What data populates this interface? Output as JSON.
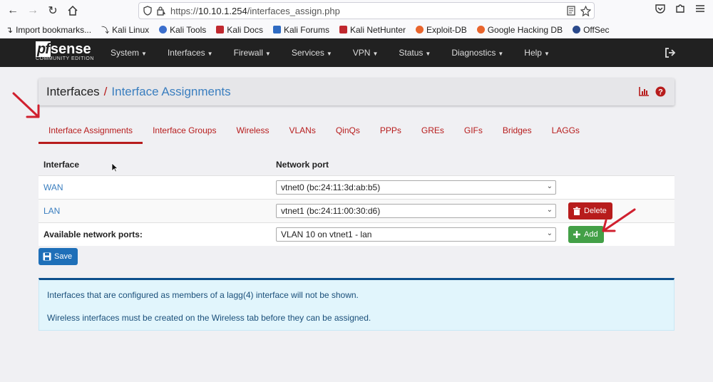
{
  "browser": {
    "url_prefix": "https://",
    "url_host": "10.10.1.254",
    "url_path": "/interfaces_assign.php",
    "bookmarks": [
      "Import bookmarks...",
      "Kali Linux",
      "Kali Tools",
      "Kali Docs",
      "Kali Forums",
      "Kali NetHunter",
      "Exploit-DB",
      "Google Hacking DB",
      "OffSec"
    ]
  },
  "navbar": {
    "logo_pf": "pf",
    "logo_sense": "sense",
    "logo_edition": "COMMUNITY EDITION",
    "menu": [
      "System",
      "Interfaces",
      "Firewall",
      "Services",
      "VPN",
      "Status",
      "Diagnostics",
      "Help"
    ]
  },
  "header": {
    "crumb_parent": "Interfaces",
    "separator": "/",
    "crumb_current": "Interface Assignments"
  },
  "tabs": [
    "Interface Assignments",
    "Interface Groups",
    "Wireless",
    "VLANs",
    "QinQs",
    "PPPs",
    "GREs",
    "GIFs",
    "Bridges",
    "LAGGs"
  ],
  "table": {
    "col_interface": "Interface",
    "col_port": "Network port",
    "rows": [
      {
        "name": "WAN",
        "port": "vtnet0 (bc:24:11:3d:ab:b5)"
      },
      {
        "name": "LAN",
        "port": "vtnet1 (bc:24:11:00:30:d6)",
        "action": "Delete"
      }
    ],
    "available_label": "Available network ports:",
    "available_value": "VLAN 10 on vtnet1 - lan",
    "add_label": "Add"
  },
  "save_label": "Save",
  "info": {
    "line1": "Interfaces that are configured as members of a lagg(4) interface will not be shown.",
    "line2": "Wireless interfaces must be created on the Wireless tab before they can be assigned."
  },
  "colors": {
    "accent_red": "#b71c1c",
    "link_blue": "#3a7ebf",
    "navbar": "#212121",
    "add_green": "#43a047",
    "save_blue": "#1e6fb8",
    "arrow_red": "#d0202f"
  }
}
